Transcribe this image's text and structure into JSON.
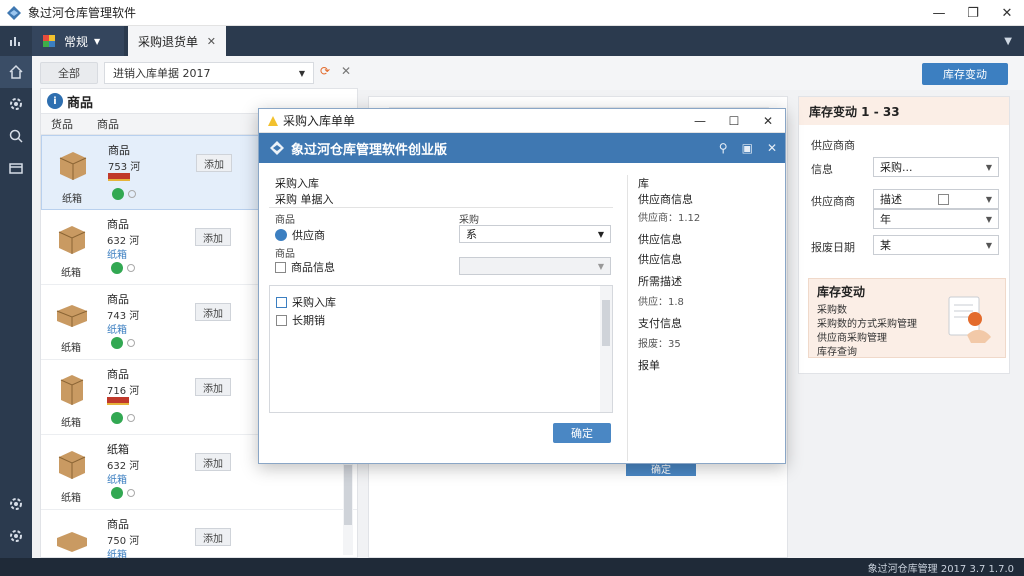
{
  "window": {
    "title": "象过河仓库管理软件",
    "min": "—",
    "max": "❐",
    "close": "✕"
  },
  "tabs": {
    "first_label": "常规",
    "active_label": "采购退货单",
    "active_close": "✕"
  },
  "toolbar": {
    "filter_label": "全部",
    "filter_value": "进销入库单据 2017",
    "primary_button": "库存变动"
  },
  "product_panel": {
    "title": "商品",
    "columns": [
      "货品",
      "商品"
    ],
    "rows": [
      {
        "name": "商品",
        "qty": "753 河",
        "category": "纸箱",
        "button": "添加"
      },
      {
        "name": "商品",
        "qty": "632 河",
        "sub": "纸箱",
        "category": "纸箱",
        "button": "添加"
      },
      {
        "name": "商品",
        "qty": "743 河",
        "sub": "纸箱",
        "category": "纸箱",
        "button": "添加"
      },
      {
        "name": "商品",
        "qty": "716 河",
        "category": "纸箱",
        "button": "添加"
      },
      {
        "name": "纸箱",
        "qty": "632 河",
        "sub": "纸箱",
        "category": "纸箱",
        "button": "添加"
      },
      {
        "name": "商品",
        "qty": "750 河",
        "sub": "纸箱",
        "category": "纸箱",
        "button": "添加"
      }
    ]
  },
  "right_panel": {
    "title": "库存变动 1 - 33",
    "supplier_heading": "供应商商",
    "info_label": "信息",
    "info_value": "采购...",
    "supplier_label": "供应商商",
    "supplier_value": "描述",
    "second_value": "年",
    "date_label": "报废日期",
    "date_value": "某"
  },
  "right_card": {
    "title": "库存变动",
    "line1": "采购数",
    "line2": "采购数的方式采购管理",
    "line3": "供应商采购管理",
    "line4": "库存查询"
  },
  "modal": {
    "title": "采购入库单单",
    "banner": "象过河仓库管理软件创业版",
    "section_title": "采购入库",
    "subtitle": "采购  单据入",
    "left_label_a": "商品",
    "right_label_a": "采购",
    "select_a": "系",
    "row1": "供应商",
    "row_header": "商品",
    "row2": "商品信息",
    "row3": "",
    "list_item1": "采购入库",
    "list_item2": "长期销",
    "confirm": "确定",
    "right_items": [
      {
        "text": "库",
        "sub": false
      },
      {
        "text": "供应商信息",
        "sub": false
      },
      {
        "text": "供应商：1.12",
        "sub": true
      },
      {
        "text": "供应信息",
        "sub": false
      },
      {
        "text": "供应信息",
        "sub": false
      },
      {
        "text": "所需描述",
        "sub": false
      },
      {
        "text": "供应：1.8",
        "sub": true
      },
      {
        "text": "支付信息",
        "sub": false
      },
      {
        "text": "报废：35",
        "sub": true
      },
      {
        "text": "报单",
        "sub": false
      }
    ]
  },
  "background_button": "确定",
  "statusbar": {
    "text": "象过河仓库管理 2017 3.7 1.7.0"
  },
  "colors": {
    "brand": "#3f78b2",
    "nav": "#2b3a4e",
    "accent": "#e36b2c"
  }
}
